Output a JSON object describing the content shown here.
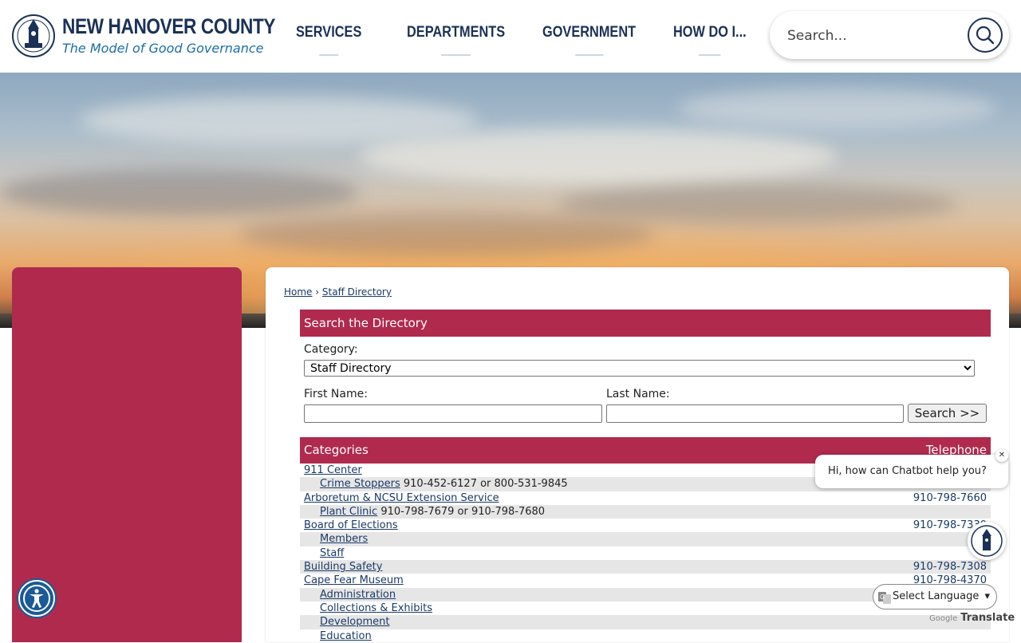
{
  "header": {
    "county_name": "NEW HANOVER COUNTY",
    "tagline": "The Model of Good Governance",
    "nav": [
      "SERVICES",
      "DEPARTMENTS",
      "GOVERNMENT",
      "HOW DO I..."
    ],
    "search_placeholder": "Search..."
  },
  "breadcrumb": {
    "home": "Home",
    "current": "Staff Directory"
  },
  "search_section": {
    "title": "Search the Directory",
    "category_label": "Category:",
    "category_value": "Staff Directory",
    "first_name_label": "First Name:",
    "last_name_label": "Last Name:",
    "search_button": "Search >>"
  },
  "directory": {
    "header_categories": "Categories",
    "header_telephone": "Telephone",
    "rows": [
      {
        "name": "911 Center",
        "extra": "",
        "phone": "",
        "level": 0,
        "alt": false
      },
      {
        "name": "Crime Stoppers",
        "extra": " 910-452-6127 or 800-531-9845",
        "phone": "",
        "level": 1,
        "alt": true
      },
      {
        "name": "Arboretum & NCSU Extension Service",
        "extra": "",
        "phone": "910-798-7660",
        "level": 0,
        "alt": false
      },
      {
        "name": "Plant Clinic",
        "extra": " 910-798-7679 or 910-798-7680",
        "phone": "",
        "level": 1,
        "alt": true
      },
      {
        "name": "Board of Elections",
        "extra": "",
        "phone": "910-798-7330",
        "level": 0,
        "alt": false
      },
      {
        "name": "Members",
        "extra": "",
        "phone": "",
        "level": 1,
        "alt": true
      },
      {
        "name": "Staff",
        "extra": "",
        "phone": "",
        "level": 1,
        "alt": false
      },
      {
        "name": "Building Safety",
        "extra": "",
        "phone": "910-798-7308",
        "level": 0,
        "alt": true
      },
      {
        "name": "Cape Fear Museum",
        "extra": "",
        "phone": "910-798-4370",
        "level": 0,
        "alt": false
      },
      {
        "name": "Administration",
        "extra": "",
        "phone": "",
        "level": 1,
        "alt": true
      },
      {
        "name": "Collections & Exhibits",
        "extra": "",
        "phone": "",
        "level": 1,
        "alt": false
      },
      {
        "name": "Development",
        "extra": "",
        "phone": "",
        "level": 1,
        "alt": true
      },
      {
        "name": "Education",
        "extra": "",
        "phone": "",
        "level": 1,
        "alt": false
      }
    ]
  },
  "chatbot": {
    "greeting": "Hi, how can Chatbot help you?",
    "close": "✕"
  },
  "translate": {
    "select_label": "Select Language",
    "powered_prefix": "Google",
    "powered_word": "Translate"
  },
  "colors": {
    "brand_navy": "#1b3157",
    "accent_crimson": "#b02a4e",
    "link_blue": "#1b3a68"
  }
}
